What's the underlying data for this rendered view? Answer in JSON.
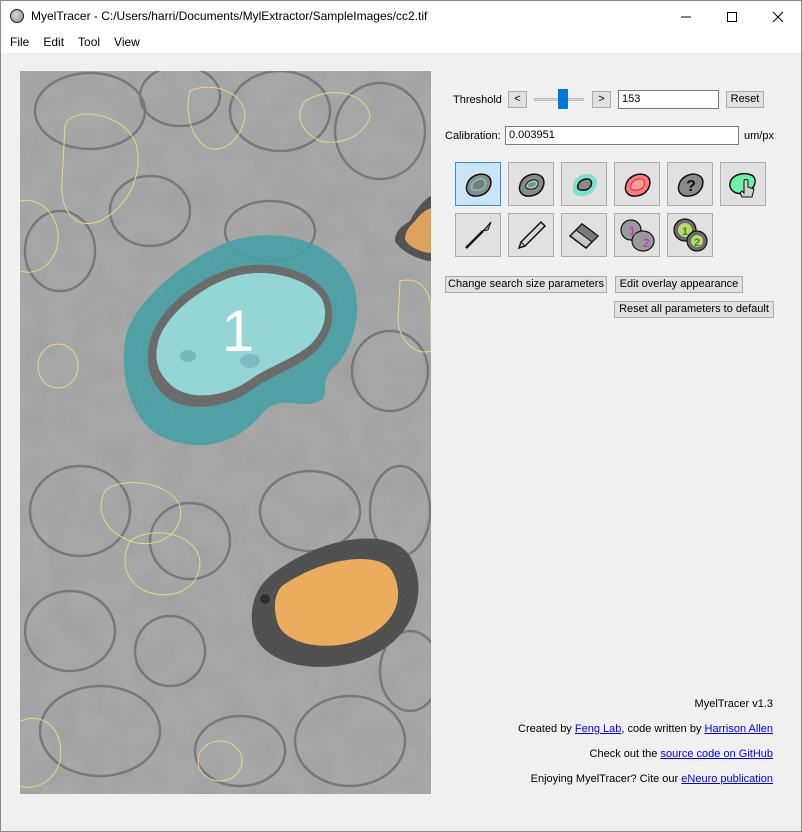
{
  "window": {
    "title": "MyelTracer - C:/Users/harri/Documents/MylExtractor/SampleImages/cc2.tif",
    "minimize": "–",
    "maximize": "☐",
    "close": "✕"
  },
  "menu": {
    "file": "File",
    "edit": "Edit",
    "tool": "Tool",
    "view": "View"
  },
  "canvas": {
    "axon_label": "1"
  },
  "controls": {
    "threshold_label": "Threshold",
    "dec_label": "<",
    "inc_label": ">",
    "threshold_value": "153",
    "threshold_level": 0.5,
    "reset_label": "Reset",
    "calibration_label": "Calibration:",
    "calibration_value": "0.003951",
    "calibration_unit": "um/px"
  },
  "tools": {
    "row1": [
      {
        "name": "tool-trace-outline-icon",
        "active": true
      },
      {
        "name": "tool-trace-inner-icon",
        "active": false
      },
      {
        "name": "tool-trace-myelin-icon",
        "active": false
      },
      {
        "name": "tool-exclude-icon",
        "active": false
      },
      {
        "name": "tool-unknown-icon",
        "active": false
      },
      {
        "name": "tool-select-icon",
        "active": false
      }
    ],
    "row2": [
      {
        "name": "tool-scalpel-icon"
      },
      {
        "name": "tool-pencil-icon"
      },
      {
        "name": "tool-eraser-icon"
      },
      {
        "name": "tool-number-icon"
      },
      {
        "name": "tool-number-pair-icon"
      }
    ]
  },
  "buttons": {
    "change_search": "Change search size parameters",
    "edit_overlay": "Edit overlay appearance",
    "reset_all": "Reset all parameters to default"
  },
  "footer": {
    "version": "MyelTracer v1.3",
    "created_by": "Created by ",
    "feng_lab": "Feng Lab",
    "code_written": ", code written by ",
    "author": "Harrison Allen",
    "check_out": "Check out the ",
    "source_code": "source code on GitHub",
    "enjoying": "Enjoying MyelTracer? Cite our ",
    "publication": "eNeuro publication"
  },
  "colors": {
    "accent": "#0078d7",
    "myelin_overlay": "#2e9aa0",
    "axon_overlay": "#8fe3e3",
    "orange_overlay": "#f5a94a",
    "trace_yellow": "#e6e07a"
  }
}
